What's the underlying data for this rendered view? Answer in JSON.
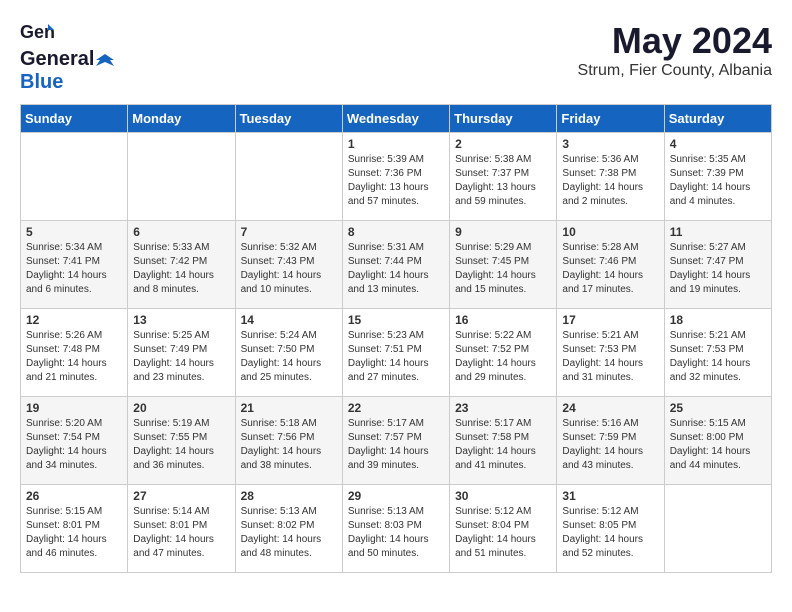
{
  "logo": {
    "general": "General",
    "blue": "Blue"
  },
  "title": {
    "month_year": "May 2024",
    "location": "Strum, Fier County, Albania"
  },
  "days_of_week": [
    "Sunday",
    "Monday",
    "Tuesday",
    "Wednesday",
    "Thursday",
    "Friday",
    "Saturday"
  ],
  "weeks": [
    {
      "days": [
        {
          "number": "",
          "content": ""
        },
        {
          "number": "",
          "content": ""
        },
        {
          "number": "",
          "content": ""
        },
        {
          "number": "1",
          "content": "Sunrise: 5:39 AM\nSunset: 7:36 PM\nDaylight: 13 hours and 57 minutes."
        },
        {
          "number": "2",
          "content": "Sunrise: 5:38 AM\nSunset: 7:37 PM\nDaylight: 13 hours and 59 minutes."
        },
        {
          "number": "3",
          "content": "Sunrise: 5:36 AM\nSunset: 7:38 PM\nDaylight: 14 hours and 2 minutes."
        },
        {
          "number": "4",
          "content": "Sunrise: 5:35 AM\nSunset: 7:39 PM\nDaylight: 14 hours and 4 minutes."
        }
      ]
    },
    {
      "days": [
        {
          "number": "5",
          "content": "Sunrise: 5:34 AM\nSunset: 7:41 PM\nDaylight: 14 hours and 6 minutes."
        },
        {
          "number": "6",
          "content": "Sunrise: 5:33 AM\nSunset: 7:42 PM\nDaylight: 14 hours and 8 minutes."
        },
        {
          "number": "7",
          "content": "Sunrise: 5:32 AM\nSunset: 7:43 PM\nDaylight: 14 hours and 10 minutes."
        },
        {
          "number": "8",
          "content": "Sunrise: 5:31 AM\nSunset: 7:44 PM\nDaylight: 14 hours and 13 minutes."
        },
        {
          "number": "9",
          "content": "Sunrise: 5:29 AM\nSunset: 7:45 PM\nDaylight: 14 hours and 15 minutes."
        },
        {
          "number": "10",
          "content": "Sunrise: 5:28 AM\nSunset: 7:46 PM\nDaylight: 14 hours and 17 minutes."
        },
        {
          "number": "11",
          "content": "Sunrise: 5:27 AM\nSunset: 7:47 PM\nDaylight: 14 hours and 19 minutes."
        }
      ]
    },
    {
      "days": [
        {
          "number": "12",
          "content": "Sunrise: 5:26 AM\nSunset: 7:48 PM\nDaylight: 14 hours and 21 minutes."
        },
        {
          "number": "13",
          "content": "Sunrise: 5:25 AM\nSunset: 7:49 PM\nDaylight: 14 hours and 23 minutes."
        },
        {
          "number": "14",
          "content": "Sunrise: 5:24 AM\nSunset: 7:50 PM\nDaylight: 14 hours and 25 minutes."
        },
        {
          "number": "15",
          "content": "Sunrise: 5:23 AM\nSunset: 7:51 PM\nDaylight: 14 hours and 27 minutes."
        },
        {
          "number": "16",
          "content": "Sunrise: 5:22 AM\nSunset: 7:52 PM\nDaylight: 14 hours and 29 minutes."
        },
        {
          "number": "17",
          "content": "Sunrise: 5:21 AM\nSunset: 7:53 PM\nDaylight: 14 hours and 31 minutes."
        },
        {
          "number": "18",
          "content": "Sunrise: 5:21 AM\nSunset: 7:53 PM\nDaylight: 14 hours and 32 minutes."
        }
      ]
    },
    {
      "days": [
        {
          "number": "19",
          "content": "Sunrise: 5:20 AM\nSunset: 7:54 PM\nDaylight: 14 hours and 34 minutes."
        },
        {
          "number": "20",
          "content": "Sunrise: 5:19 AM\nSunset: 7:55 PM\nDaylight: 14 hours and 36 minutes."
        },
        {
          "number": "21",
          "content": "Sunrise: 5:18 AM\nSunset: 7:56 PM\nDaylight: 14 hours and 38 minutes."
        },
        {
          "number": "22",
          "content": "Sunrise: 5:17 AM\nSunset: 7:57 PM\nDaylight: 14 hours and 39 minutes."
        },
        {
          "number": "23",
          "content": "Sunrise: 5:17 AM\nSunset: 7:58 PM\nDaylight: 14 hours and 41 minutes."
        },
        {
          "number": "24",
          "content": "Sunrise: 5:16 AM\nSunset: 7:59 PM\nDaylight: 14 hours and 43 minutes."
        },
        {
          "number": "25",
          "content": "Sunrise: 5:15 AM\nSunset: 8:00 PM\nDaylight: 14 hours and 44 minutes."
        }
      ]
    },
    {
      "days": [
        {
          "number": "26",
          "content": "Sunrise: 5:15 AM\nSunset: 8:01 PM\nDaylight: 14 hours and 46 minutes."
        },
        {
          "number": "27",
          "content": "Sunrise: 5:14 AM\nSunset: 8:01 PM\nDaylight: 14 hours and 47 minutes."
        },
        {
          "number": "28",
          "content": "Sunrise: 5:13 AM\nSunset: 8:02 PM\nDaylight: 14 hours and 48 minutes."
        },
        {
          "number": "29",
          "content": "Sunrise: 5:13 AM\nSunset: 8:03 PM\nDaylight: 14 hours and 50 minutes."
        },
        {
          "number": "30",
          "content": "Sunrise: 5:12 AM\nSunset: 8:04 PM\nDaylight: 14 hours and 51 minutes."
        },
        {
          "number": "31",
          "content": "Sunrise: 5:12 AM\nSunset: 8:05 PM\nDaylight: 14 hours and 52 minutes."
        },
        {
          "number": "",
          "content": ""
        }
      ]
    }
  ]
}
